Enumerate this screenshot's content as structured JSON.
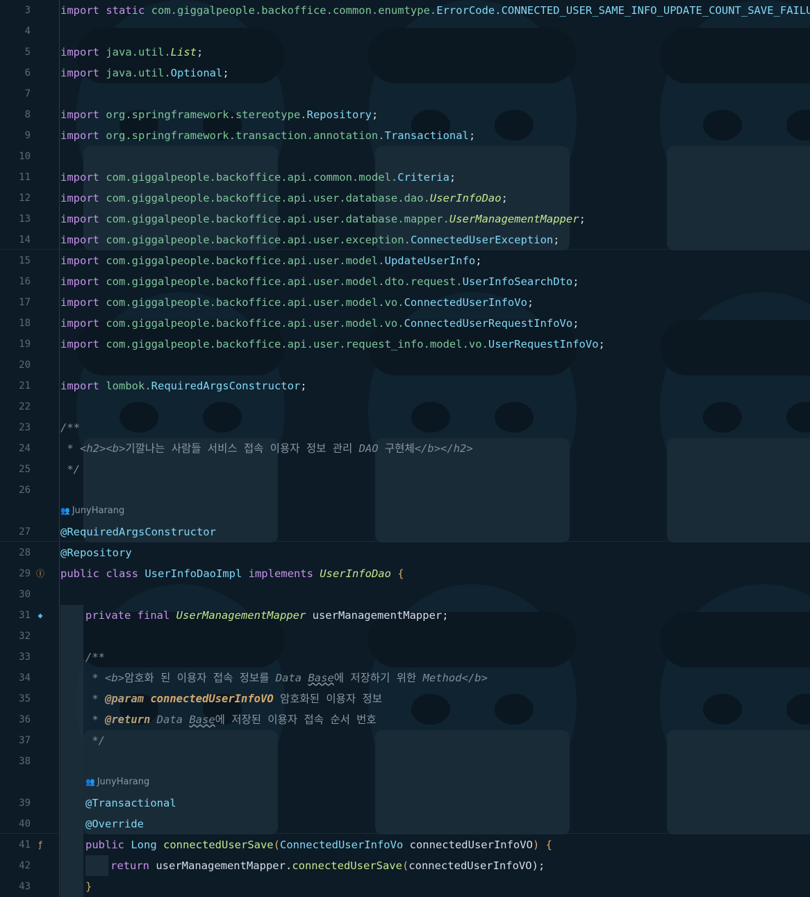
{
  "author_hint": "JunyHarang",
  "lines": [
    {
      "n": "3",
      "tokens": [
        [
          "import ",
          "k"
        ],
        [
          "static ",
          "k"
        ],
        [
          "com.giggalpeople.backoffice.common.enumtype.",
          "pk"
        ],
        [
          "ErrorCode",
          "ty"
        ],
        [
          ".CONNECTED_USER_SAME_INFO_UPDATE_COUNT_SAVE_FAILURE",
          "ty"
        ],
        [
          ";",
          "pl"
        ]
      ]
    },
    {
      "n": "4",
      "tokens": []
    },
    {
      "n": "5",
      "tokens": [
        [
          "import ",
          "k"
        ],
        [
          "java.util.",
          "pk"
        ],
        [
          "List",
          "ity"
        ],
        [
          ";",
          "pl"
        ]
      ]
    },
    {
      "n": "6",
      "tokens": [
        [
          "import ",
          "k"
        ],
        [
          "java.util.",
          "pk"
        ],
        [
          "Optional",
          "ty"
        ],
        [
          ";",
          "pl"
        ]
      ]
    },
    {
      "n": "7",
      "tokens": []
    },
    {
      "n": "8",
      "tokens": [
        [
          "import ",
          "k"
        ],
        [
          "org.springframework.stereotype.",
          "pk"
        ],
        [
          "Repository",
          "ty"
        ],
        [
          ";",
          "pl"
        ]
      ]
    },
    {
      "n": "9",
      "tokens": [
        [
          "import ",
          "k"
        ],
        [
          "org.springframework.transaction.annotation.",
          "pk"
        ],
        [
          "Transactional",
          "ty"
        ],
        [
          ";",
          "pl"
        ]
      ]
    },
    {
      "n": "10",
      "tokens": []
    },
    {
      "n": "11",
      "tokens": [
        [
          "import ",
          "k"
        ],
        [
          "com.giggalpeople.backoffice.api.common.model.",
          "pk"
        ],
        [
          "Criteria",
          "ty"
        ],
        [
          ";",
          "pl"
        ]
      ]
    },
    {
      "n": "12",
      "tokens": [
        [
          "import ",
          "k"
        ],
        [
          "com.giggalpeople.backoffice.api.user.database.dao.",
          "pk"
        ],
        [
          "UserInfoDao",
          "ity"
        ],
        [
          ";",
          "pl"
        ]
      ]
    },
    {
      "n": "13",
      "tokens": [
        [
          "import ",
          "k"
        ],
        [
          "com.giggalpeople.backoffice.api.user.database.mapper.",
          "pk"
        ],
        [
          "UserManagementMapper",
          "ity"
        ],
        [
          ";",
          "pl"
        ]
      ]
    },
    {
      "n": "14",
      "tokens": [
        [
          "import ",
          "k"
        ],
        [
          "com.giggalpeople.backoffice.api.user.exception.",
          "pk"
        ],
        [
          "ConnectedUserException",
          "ty"
        ],
        [
          ";",
          "pl"
        ]
      ]
    },
    {
      "n": "15",
      "tokens": [
        [
          "import ",
          "k"
        ],
        [
          "com.giggalpeople.backoffice.api.user.model.",
          "pk"
        ],
        [
          "UpdateUserInfo",
          "ty"
        ],
        [
          ";",
          "pl"
        ]
      ]
    },
    {
      "n": "16",
      "tokens": [
        [
          "import ",
          "k"
        ],
        [
          "com.giggalpeople.backoffice.api.user.model.dto.request.",
          "pk"
        ],
        [
          "UserInfoSearchDto",
          "ty"
        ],
        [
          ";",
          "pl"
        ]
      ]
    },
    {
      "n": "17",
      "tokens": [
        [
          "import ",
          "k"
        ],
        [
          "com.giggalpeople.backoffice.api.user.model.vo.",
          "pk"
        ],
        [
          "ConnectedUserInfoVo",
          "ty"
        ],
        [
          ";",
          "pl"
        ]
      ]
    },
    {
      "n": "18",
      "tokens": [
        [
          "import ",
          "k"
        ],
        [
          "com.giggalpeople.backoffice.api.user.model.vo.",
          "pk"
        ],
        [
          "ConnectedUserRequestInfoVo",
          "ty"
        ],
        [
          ";",
          "pl"
        ]
      ]
    },
    {
      "n": "19",
      "tokens": [
        [
          "import ",
          "k"
        ],
        [
          "com.giggalpeople.backoffice.api.user.request_info.model.vo.",
          "pk"
        ],
        [
          "UserRequestInfoVo",
          "ty"
        ],
        [
          ";",
          "pl"
        ]
      ]
    },
    {
      "n": "20",
      "tokens": []
    },
    {
      "n": "21",
      "tokens": [
        [
          "import ",
          "k"
        ],
        [
          "lombok.",
          "pk"
        ],
        [
          "RequiredArgsConstructor",
          "ty"
        ],
        [
          ";",
          "pl"
        ]
      ]
    },
    {
      "n": "22",
      "tokens": []
    },
    {
      "n": "23",
      "tokens": [
        [
          "/**",
          "cm"
        ]
      ]
    },
    {
      "n": "24",
      "tokens": [
        [
          " * ",
          "cm"
        ],
        [
          "<h2><b>",
          "tag"
        ],
        [
          "기깔나는 사람들 서비스 접속 이용자 정보 관리 ",
          "cm2"
        ],
        [
          "DAO",
          "cm"
        ],
        [
          " 구현체",
          "cm2"
        ],
        [
          "</b></h2>",
          "tag"
        ]
      ]
    },
    {
      "n": "25",
      "tokens": [
        [
          " */",
          "cm"
        ]
      ]
    },
    {
      "n": "26",
      "tokens": []
    },
    {
      "n": "27",
      "tokens": [
        [
          "@RequiredArgsConstructor",
          "ann"
        ]
      ]
    },
    {
      "n": "28",
      "tokens": [
        [
          "@Repository",
          "ann"
        ]
      ]
    },
    {
      "n": "29",
      "icon": "implementation-icon",
      "glyph": "Ⓘ",
      "tokens": [
        [
          "public ",
          "k"
        ],
        [
          "class ",
          "k"
        ],
        [
          "UserInfoDaoImpl ",
          "ty"
        ],
        [
          "implements ",
          "k"
        ],
        [
          "UserInfoDao",
          "ity"
        ],
        [
          " {",
          "par"
        ]
      ]
    },
    {
      "n": "30",
      "tokens": []
    },
    {
      "n": "31",
      "icon": "bean-icon",
      "glyph": "◆",
      "indent": 1,
      "tokens": [
        [
          "private ",
          "k"
        ],
        [
          "final ",
          "k"
        ],
        [
          "UserManagementMapper",
          "ity"
        ],
        [
          " userManagementMapper;",
          "pl"
        ]
      ]
    },
    {
      "n": "32",
      "tokens": []
    },
    {
      "n": "33",
      "indent": 1,
      "tokens": [
        [
          "/**",
          "cm"
        ]
      ]
    },
    {
      "n": "34",
      "indent": 1,
      "tokens": [
        [
          " * ",
          "cm"
        ],
        [
          "<b>",
          "tag"
        ],
        [
          "암호화 된 이용자 접속 정보를 ",
          "cm2"
        ],
        [
          "Data ",
          "cm"
        ],
        [
          "Base",
          "cmw"
        ],
        [
          "에 저장하기 위한 ",
          "cm2"
        ],
        [
          "Method",
          "cm"
        ],
        [
          "</b>",
          "tag"
        ]
      ]
    },
    {
      "n": "35",
      "indent": 1,
      "tokens": [
        [
          " * ",
          "cm"
        ],
        [
          "@param",
          "jd"
        ],
        [
          " ",
          "cm"
        ],
        [
          "connectedUserInfoVO",
          "jdp"
        ],
        [
          " 암호화된 이용자 정보",
          "cm2"
        ]
      ]
    },
    {
      "n": "36",
      "indent": 1,
      "tokens": [
        [
          " * ",
          "cm"
        ],
        [
          "@return",
          "jd"
        ],
        [
          " Data ",
          "cm"
        ],
        [
          "Base",
          "cmw"
        ],
        [
          "에 저장된 이용자 접속 순서 번호",
          "cm2"
        ]
      ]
    },
    {
      "n": "37",
      "indent": 1,
      "tokens": [
        [
          " */",
          "cm"
        ]
      ]
    },
    {
      "n": "38",
      "tokens": []
    },
    {
      "n": "39",
      "indent": 1,
      "tokens": [
        [
          "@Transactional",
          "ann"
        ]
      ]
    },
    {
      "n": "40",
      "indent": 1,
      "tokens": [
        [
          "@Override",
          "ann"
        ]
      ]
    },
    {
      "n": "41",
      "icon": "override-method-icon",
      "glyph": "ƒ",
      "indent": 1,
      "tokens": [
        [
          "public ",
          "k"
        ],
        [
          "Long ",
          "ty"
        ],
        [
          "connectedUserSave",
          "fn"
        ],
        [
          "(",
          "par"
        ],
        [
          "ConnectedUserInfoVo ",
          "ty"
        ],
        [
          "connectedUserInfoVO",
          "pl"
        ],
        [
          ") ",
          "par"
        ],
        [
          "{",
          "par"
        ]
      ]
    },
    {
      "n": "42",
      "indent": 2,
      "tokens": [
        [
          "return ",
          "k"
        ],
        [
          "userManagementMapper",
          "pl"
        ],
        [
          ".",
          "pl"
        ],
        [
          "connectedUserSave",
          "fn"
        ],
        [
          "(",
          "par"
        ],
        [
          "connectedUserInfoVO",
          "pl"
        ],
        [
          ");",
          "pl"
        ]
      ]
    },
    {
      "n": "43",
      "indent": 1,
      "tokens": [
        [
          "}",
          "par"
        ]
      ]
    }
  ],
  "hints": [
    {
      "after_line": "26",
      "indent": 0,
      "text": "JunyHarang"
    },
    {
      "after_line": "38",
      "indent": 1,
      "text": "JunyHarang"
    }
  ]
}
